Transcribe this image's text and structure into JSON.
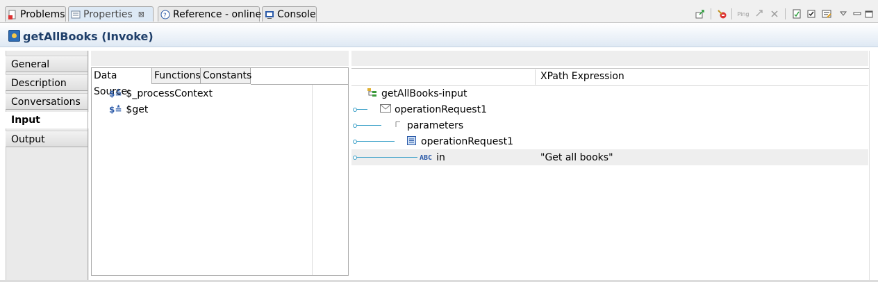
{
  "tabs": [
    {
      "label": "Problems",
      "icon": "problems-icon",
      "active": false
    },
    {
      "label": "Properties",
      "icon": "properties-icon",
      "active": true,
      "close": "⊠"
    },
    {
      "label": "Reference - online",
      "icon": "help-icon",
      "active": false
    },
    {
      "label": "Console",
      "icon": "console-icon",
      "active": false
    }
  ],
  "toolbar": {
    "ping_label": "Ping",
    "icons": [
      "export-icon",
      "stop-icon",
      "ping-icon",
      "link-icon",
      "close-all-icon",
      "verify-icon",
      "check-icon",
      "filter-icon",
      "view-menu-icon",
      "minimize-icon",
      "maximize-icon"
    ]
  },
  "title": "getAllBooks (Invoke)",
  "categories": [
    "General",
    "Description",
    "Conversations",
    "Input",
    "Output"
  ],
  "active_category": "Input",
  "data_source": {
    "tabs": [
      "Data Source",
      "Functions",
      "Constants"
    ],
    "items": [
      "$_processContext",
      "$get"
    ]
  },
  "mapping": {
    "column_header": "XPath Expression",
    "rows": [
      {
        "label": "getAllBooks-input",
        "icon": "schema-root-icon",
        "xpath": ""
      },
      {
        "label": "operationRequest1",
        "icon": "message-icon",
        "xpath": ""
      },
      {
        "label": "parameters",
        "icon": "element-icon",
        "xpath": ""
      },
      {
        "label": "operationRequest1",
        "icon": "complex-type-icon",
        "xpath": ""
      },
      {
        "label": "in",
        "icon": "string-type-icon",
        "type_text": "ABC",
        "xpath": "\"Get all books\""
      }
    ]
  }
}
